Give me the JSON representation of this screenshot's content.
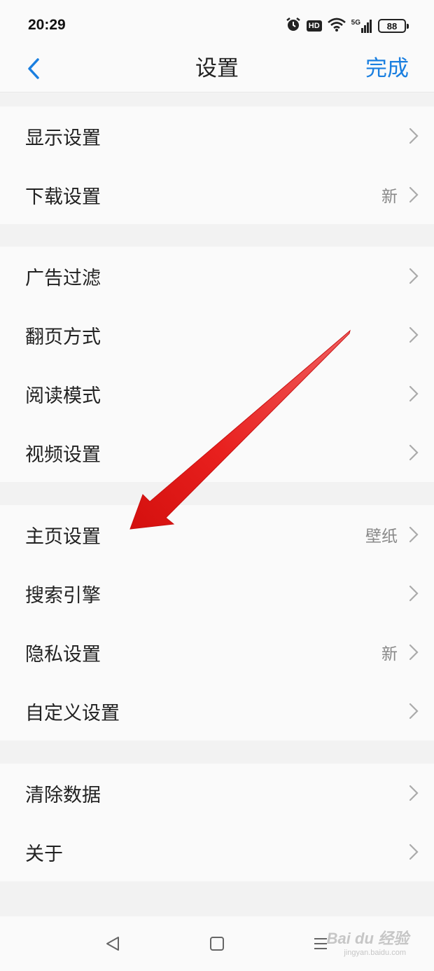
{
  "status_bar": {
    "time": "20:29",
    "hd_label": "HD",
    "network_label": "5G",
    "battery": "88"
  },
  "header": {
    "title": "设置",
    "done_label": "完成"
  },
  "groups": [
    {
      "items": [
        {
          "label": "显示设置",
          "value": ""
        },
        {
          "label": "下载设置",
          "value": "新"
        }
      ]
    },
    {
      "items": [
        {
          "label": "广告过滤",
          "value": ""
        },
        {
          "label": "翻页方式",
          "value": ""
        },
        {
          "label": "阅读模式",
          "value": ""
        },
        {
          "label": "视频设置",
          "value": ""
        }
      ]
    },
    {
      "items": [
        {
          "label": "主页设置",
          "value": "壁纸"
        },
        {
          "label": "搜索引擎",
          "value": ""
        },
        {
          "label": "隐私设置",
          "value": "新"
        },
        {
          "label": "自定义设置",
          "value": ""
        }
      ]
    },
    {
      "items": [
        {
          "label": "清除数据",
          "value": ""
        },
        {
          "label": "关于",
          "value": ""
        }
      ]
    }
  ],
  "watermark": {
    "main": "Bai du 经验",
    "sub": "jingyan.baidu.com"
  },
  "colors": {
    "accent": "#1a7fe0",
    "annotation_arrow": "#e8201e"
  }
}
